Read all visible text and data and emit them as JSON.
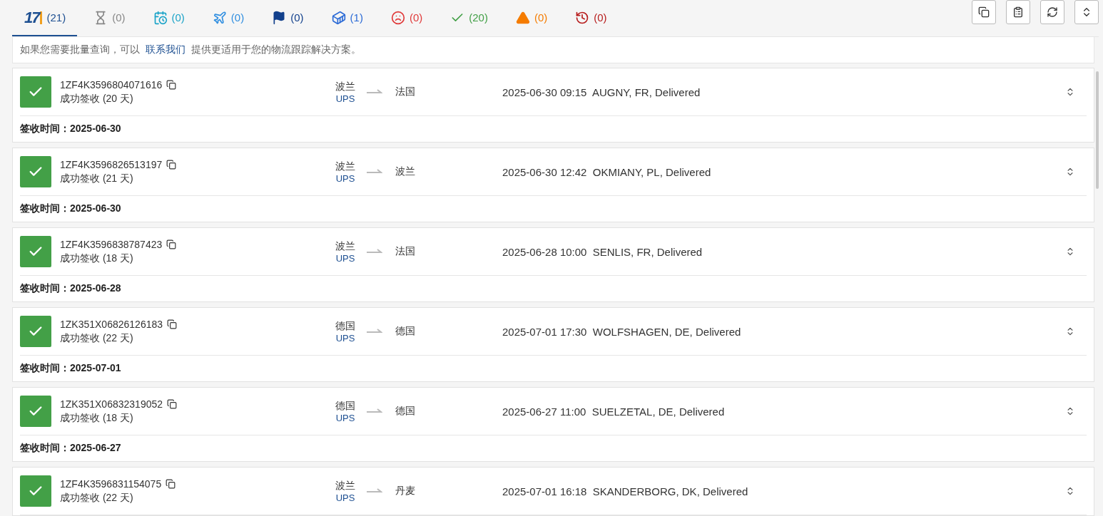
{
  "tabs": [
    {
      "kind": "logo",
      "logo_text": "17",
      "count": "(21)",
      "color": "#1d4f91",
      "selected": true
    },
    {
      "kind": "hourglass",
      "count": "(0)",
      "color": "#888888",
      "selected": false
    },
    {
      "kind": "calendar",
      "count": "(0)",
      "color": "#1aa3c8",
      "selected": false
    },
    {
      "kind": "plane",
      "count": "(0)",
      "color": "#2f8ee0",
      "selected": false
    },
    {
      "kind": "flag",
      "count": "(0)",
      "color": "#12408c",
      "selected": false
    },
    {
      "kind": "ship",
      "count": "(1)",
      "color": "#2c6bd6",
      "selected": false
    },
    {
      "kind": "sad",
      "count": "(0)",
      "color": "#e03a3a",
      "selected": false
    },
    {
      "kind": "check",
      "count": "(20)",
      "color": "#43a047",
      "selected": false
    },
    {
      "kind": "warning",
      "count": "(0)",
      "color": "#f57c00",
      "selected": false
    },
    {
      "kind": "history",
      "count": "(0)",
      "color": "#b71c1c",
      "selected": false
    }
  ],
  "toolbar": [
    {
      "kind": "copy"
    },
    {
      "kind": "copy-list"
    },
    {
      "kind": "refresh"
    },
    {
      "kind": "expand"
    }
  ],
  "notice": {
    "before": "如果您需要批量查询，可以",
    "link": "联系我们",
    "after": "提供更适用于您的物流跟踪解决方案。"
  },
  "shipments": [
    {
      "number": "1ZF4K3596804071616",
      "status": "成功签收 (20 天)",
      "origin": "波兰",
      "carrier": "UPS",
      "destination": "法国",
      "event": "2025-06-30 09:15  AUGNY, FR, Delivered",
      "delivered_label": "签收时间：",
      "delivered_date": "2025-06-30"
    },
    {
      "number": "1ZF4K3596826513197",
      "status": "成功签收 (21 天)",
      "origin": "波兰",
      "carrier": "UPS",
      "destination": "波兰",
      "event": "2025-06-30 12:42  OKMIANY, PL, Delivered",
      "delivered_label": "签收时间：",
      "delivered_date": "2025-06-30"
    },
    {
      "number": "1ZF4K3596838787423",
      "status": "成功签收 (18 天)",
      "origin": "波兰",
      "carrier": "UPS",
      "destination": "法国",
      "event": "2025-06-28 10:00  SENLIS, FR, Delivered",
      "delivered_label": "签收时间：",
      "delivered_date": "2025-06-28"
    },
    {
      "number": "1ZK351X06826126183",
      "status": "成功签收 (22 天)",
      "origin": "德国",
      "carrier": "UPS",
      "destination": "德国",
      "event": "2025-07-01 17:30  WOLFSHAGEN, DE, Delivered",
      "delivered_label": "签收时间：",
      "delivered_date": "2025-07-01"
    },
    {
      "number": "1ZK351X06832319052",
      "status": "成功签收 (18 天)",
      "origin": "德国",
      "carrier": "UPS",
      "destination": "德国",
      "event": "2025-06-27 11:00  SUELZETAL, DE, Delivered",
      "delivered_label": "签收时间：",
      "delivered_date": "2025-06-27"
    },
    {
      "number": "1ZF4K3596831154075",
      "status": "成功签收 (22 天)",
      "origin": "波兰",
      "carrier": "UPS",
      "destination": "丹麦",
      "event": "2025-07-01 16:18  SKANDERBORG, DK, Delivered"
    }
  ]
}
